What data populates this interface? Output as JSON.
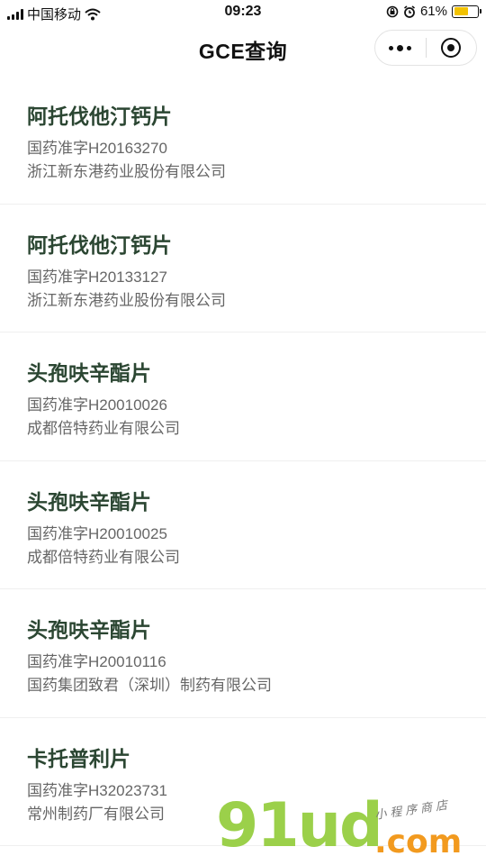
{
  "status_bar": {
    "carrier": "中国移动",
    "time": "09:23",
    "battery_text": "61%",
    "battery_level": 0.61,
    "battery_color": "#f2c200"
  },
  "nav": {
    "title": "GCE查询",
    "more_icon": "more-dots-icon",
    "close_icon": "record-circle-icon"
  },
  "colors": {
    "name_text": "#2b4632",
    "meta_text": "#666666"
  },
  "items": [
    {
      "name": "阿托伐他汀钙片",
      "code": "国药准字H20163270",
      "company": "浙江新东港药业股份有限公司"
    },
    {
      "name": "阿托伐他汀钙片",
      "code": "国药准字H20133127",
      "company": "浙江新东港药业股份有限公司"
    },
    {
      "name": "头孢呋辛酯片",
      "code": "国药准字H20010026",
      "company": "成都倍特药业有限公司"
    },
    {
      "name": "头孢呋辛酯片",
      "code": "国药准字H20010025",
      "company": "成都倍特药业有限公司"
    },
    {
      "name": "头孢呋辛酯片",
      "code": "国药准字H20010116",
      "company": "国药集团致君（深圳）制药有限公司"
    },
    {
      "name": "卡托普利片",
      "code": "国药准字H32023731",
      "company": "常州制药厂有限公司"
    }
  ],
  "watermark": {
    "main": "91ud",
    "suffix": ".com",
    "tag": "小程序商店"
  }
}
